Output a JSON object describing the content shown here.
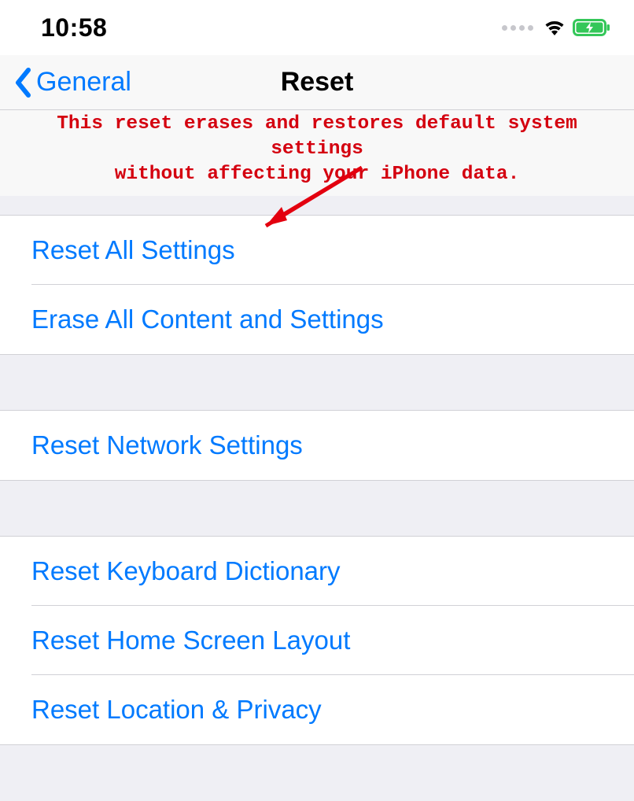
{
  "status": {
    "time": "10:58"
  },
  "nav": {
    "back": "General",
    "title": "Reset"
  },
  "annotation": {
    "line1": "This reset erases and restores default system settings",
    "line2": "without affecting your iPhone data."
  },
  "groups": [
    {
      "items": [
        {
          "label": "Reset All Settings"
        },
        {
          "label": "Erase All Content and Settings"
        }
      ]
    },
    {
      "items": [
        {
          "label": "Reset Network Settings"
        }
      ]
    },
    {
      "items": [
        {
          "label": "Reset Keyboard Dictionary"
        },
        {
          "label": "Reset Home Screen Layout"
        },
        {
          "label": "Reset Location & Privacy"
        }
      ]
    }
  ]
}
